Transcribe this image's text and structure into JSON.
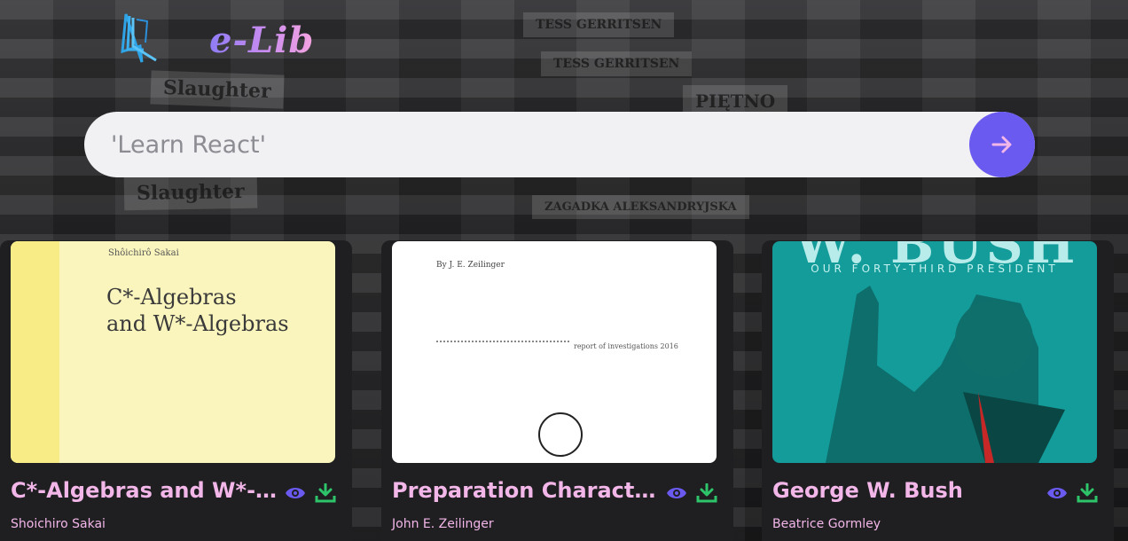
{
  "app": {
    "name": "e-Lib",
    "logo_icon": "book-icon"
  },
  "search": {
    "placeholder": "'Learn React'",
    "value": "",
    "submit_icon": "arrow-right-icon"
  },
  "colors": {
    "accent": "#6a5af0",
    "title_pink": "#f3b6e8",
    "eye_icon": "#6a5af0",
    "download_icon": "#2ec56a",
    "card_bg": "#1f1f22"
  },
  "books": [
    {
      "title": "C*-Algebras and W*-Algebras",
      "author": "Shoichiro Sakai",
      "cover": {
        "top_text": "Shôichirô Sakai",
        "title_line1": "C*-Algebras",
        "title_line2": "and W*-Algebras"
      }
    },
    {
      "title": "Preparation Characterization of Entangled States",
      "author": "John E. Zeilinger",
      "cover": {
        "top_text": "By J. E. Zeilinger",
        "line_text": "report of investigations 2016"
      }
    },
    {
      "title": "George W. Bush",
      "author": "Beatrice Gormley",
      "cover": {
        "top_text": "W. BUSH",
        "subtitle": "OUR FORTY-THIRD PRESIDENT"
      }
    }
  ]
}
